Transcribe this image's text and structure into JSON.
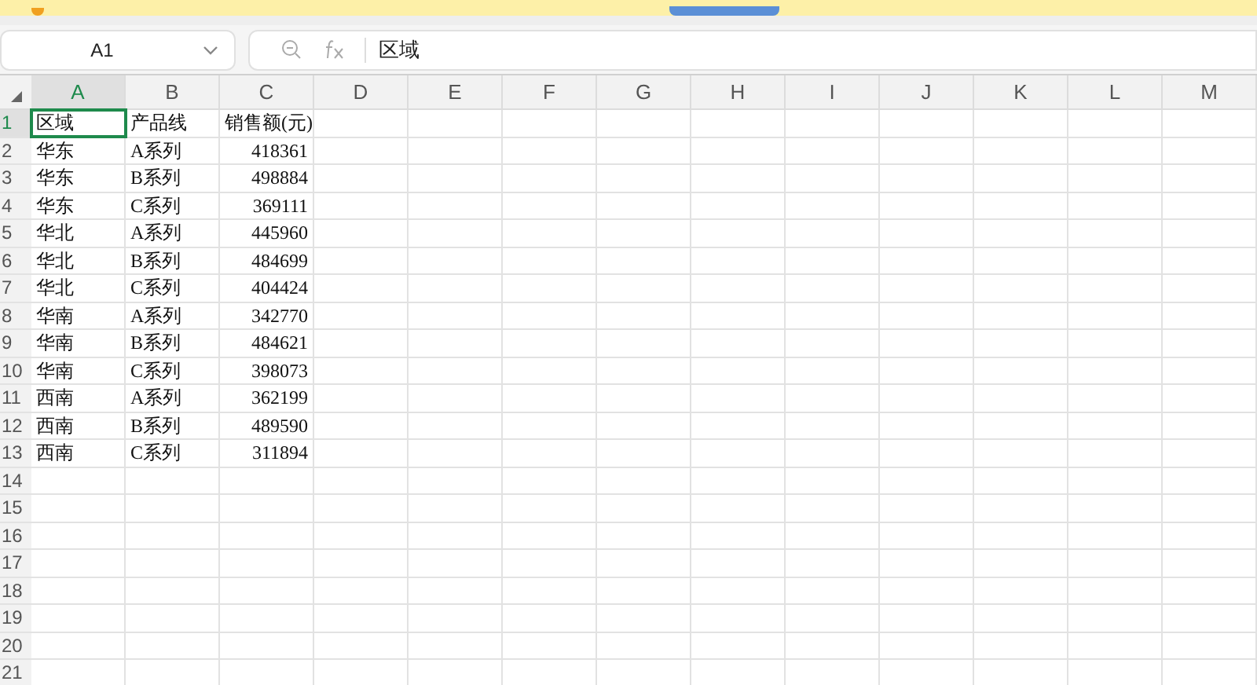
{
  "name_box": {
    "value": "A1"
  },
  "formula_bar": {
    "value": "区域"
  },
  "columns": [
    {
      "label": "A",
      "selected": true
    },
    {
      "label": "B",
      "selected": false
    },
    {
      "label": "C",
      "selected": false
    },
    {
      "label": "D",
      "selected": false
    },
    {
      "label": "E",
      "selected": false
    },
    {
      "label": "F",
      "selected": false
    },
    {
      "label": "G",
      "selected": false
    },
    {
      "label": "H",
      "selected": false
    },
    {
      "label": "I",
      "selected": false
    },
    {
      "label": "J",
      "selected": false
    },
    {
      "label": "K",
      "selected": false
    },
    {
      "label": "L",
      "selected": false
    },
    {
      "label": "M",
      "selected": false
    }
  ],
  "rows": [
    {
      "number": "1",
      "selected": true,
      "cells": [
        {
          "text": "区域",
          "kind": "text",
          "selected": true
        },
        {
          "text": "产品线",
          "kind": "text",
          "selected": false
        },
        {
          "text": "销售额(元)",
          "kind": "text",
          "selected": false
        }
      ]
    },
    {
      "number": "2",
      "selected": false,
      "cells": [
        {
          "text": "华东",
          "kind": "text",
          "selected": false
        },
        {
          "text": "A系列",
          "kind": "text",
          "selected": false
        },
        {
          "text": "418361",
          "kind": "number",
          "selected": false
        }
      ]
    },
    {
      "number": "3",
      "selected": false,
      "cells": [
        {
          "text": "华东",
          "kind": "text",
          "selected": false
        },
        {
          "text": "B系列",
          "kind": "text",
          "selected": false
        },
        {
          "text": "498884",
          "kind": "number",
          "selected": false
        }
      ]
    },
    {
      "number": "4",
      "selected": false,
      "cells": [
        {
          "text": "华东",
          "kind": "text",
          "selected": false
        },
        {
          "text": "C系列",
          "kind": "text",
          "selected": false
        },
        {
          "text": "369111",
          "kind": "number",
          "selected": false
        }
      ]
    },
    {
      "number": "5",
      "selected": false,
      "cells": [
        {
          "text": "华北",
          "kind": "text",
          "selected": false
        },
        {
          "text": "A系列",
          "kind": "text",
          "selected": false
        },
        {
          "text": "445960",
          "kind": "number",
          "selected": false
        }
      ]
    },
    {
      "number": "6",
      "selected": false,
      "cells": [
        {
          "text": "华北",
          "kind": "text",
          "selected": false
        },
        {
          "text": "B系列",
          "kind": "text",
          "selected": false
        },
        {
          "text": "484699",
          "kind": "number",
          "selected": false
        }
      ]
    },
    {
      "number": "7",
      "selected": false,
      "cells": [
        {
          "text": "华北",
          "kind": "text",
          "selected": false
        },
        {
          "text": "C系列",
          "kind": "text",
          "selected": false
        },
        {
          "text": "404424",
          "kind": "number",
          "selected": false
        }
      ]
    },
    {
      "number": "8",
      "selected": false,
      "cells": [
        {
          "text": "华南",
          "kind": "text",
          "selected": false
        },
        {
          "text": "A系列",
          "kind": "text",
          "selected": false
        },
        {
          "text": "342770",
          "kind": "number",
          "selected": false
        }
      ]
    },
    {
      "number": "9",
      "selected": false,
      "cells": [
        {
          "text": "华南",
          "kind": "text",
          "selected": false
        },
        {
          "text": "B系列",
          "kind": "text",
          "selected": false
        },
        {
          "text": "484621",
          "kind": "number",
          "selected": false
        }
      ]
    },
    {
      "number": "10",
      "selected": false,
      "cells": [
        {
          "text": "华南",
          "kind": "text",
          "selected": false
        },
        {
          "text": "C系列",
          "kind": "text",
          "selected": false
        },
        {
          "text": "398073",
          "kind": "number",
          "selected": false
        }
      ]
    },
    {
      "number": "11",
      "selected": false,
      "cells": [
        {
          "text": "西南",
          "kind": "text",
          "selected": false
        },
        {
          "text": "A系列",
          "kind": "text",
          "selected": false
        },
        {
          "text": "362199",
          "kind": "number",
          "selected": false
        }
      ]
    },
    {
      "number": "12",
      "selected": false,
      "cells": [
        {
          "text": "西南",
          "kind": "text",
          "selected": false
        },
        {
          "text": "B系列",
          "kind": "text",
          "selected": false
        },
        {
          "text": "489590",
          "kind": "number",
          "selected": false
        }
      ]
    },
    {
      "number": "13",
      "selected": false,
      "cells": [
        {
          "text": "西南",
          "kind": "text",
          "selected": false
        },
        {
          "text": "C系列",
          "kind": "text",
          "selected": false
        },
        {
          "text": "311894",
          "kind": "number",
          "selected": false
        }
      ]
    },
    {
      "number": "14",
      "selected": false
    },
    {
      "number": "15",
      "selected": false
    },
    {
      "number": "16",
      "selected": false
    },
    {
      "number": "17",
      "selected": false
    },
    {
      "number": "18",
      "selected": false
    },
    {
      "number": "19",
      "selected": false
    },
    {
      "number": "20",
      "selected": false
    },
    {
      "number": "21",
      "selected": false
    }
  ]
}
